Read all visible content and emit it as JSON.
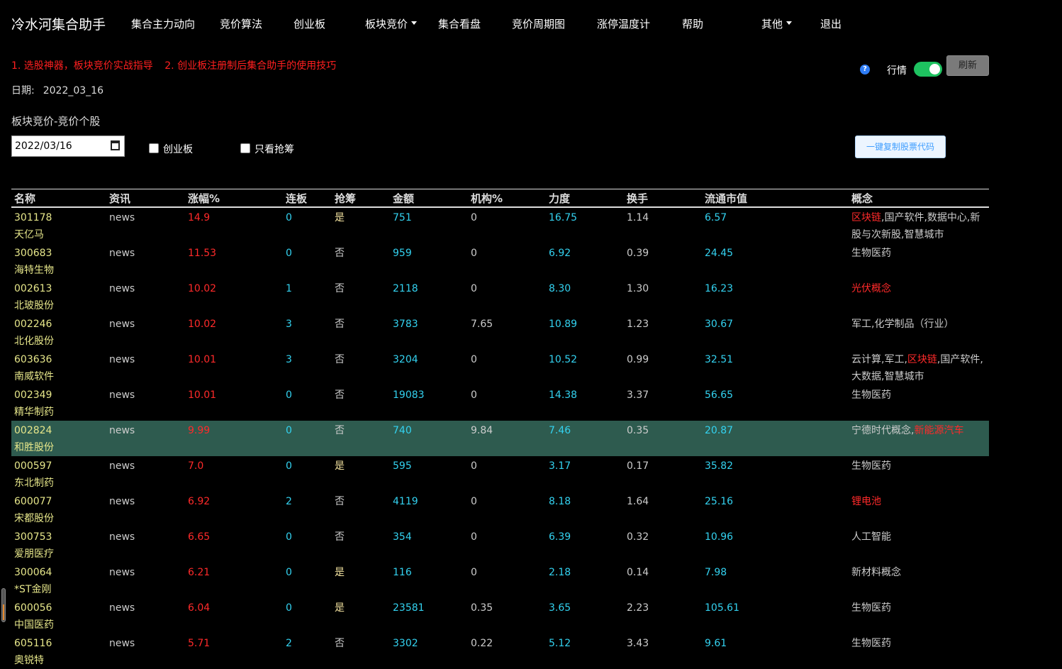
{
  "nav": {
    "brand": "冷水河集合助手",
    "items": [
      {
        "label": "集合主力动向",
        "name": "nav-main-force",
        "dropdown": false
      },
      {
        "label": "竞价算法",
        "name": "nav-bid-algorithm",
        "dropdown": false
      },
      {
        "label": "创业板",
        "name": "nav-gem",
        "dropdown": false
      },
      {
        "label": "板块竞价",
        "name": "nav-sector-bid",
        "dropdown": true
      },
      {
        "label": "集合看盘",
        "name": "nav-watch",
        "dropdown": false
      },
      {
        "label": "竞价周期图",
        "name": "nav-bid-cycle",
        "dropdown": false
      },
      {
        "label": "涨停温度计",
        "name": "nav-limit-up-thermometer",
        "dropdown": false
      },
      {
        "label": "帮助",
        "name": "nav-help",
        "dropdown": false
      },
      {
        "label": "其他",
        "name": "nav-other",
        "dropdown": true
      },
      {
        "label": "退出",
        "name": "nav-logout",
        "dropdown": false
      }
    ]
  },
  "links": {
    "link1": "1. 选股神器，板块竞价实战指导",
    "link2": "2. 创业板注册制后集合助手的使用技巧"
  },
  "date": {
    "label": "日期:",
    "value": "2022_03_16"
  },
  "section_title": "板块竞价-竞价个股",
  "controls": {
    "help_icon": "question-icon",
    "quote_label": "行情",
    "quote_toggle_on": true,
    "refresh_label": "刷新",
    "date_input_value": "2022/03/16",
    "checkbox_gem_label": "创业板",
    "checkbox_gem_checked": false,
    "checkbox_grab_label": "只看抢筹",
    "checkbox_grab_checked": false,
    "copy_button_label": "一键复制股票代码"
  },
  "colors": {
    "background": "#000000",
    "name_color": "#e6e68a",
    "rise_color": "#ff2a2a",
    "cyan_color": "#33d2f0",
    "highlight_row": "#2e5b4f",
    "toggle_on": "#1ec260"
  },
  "table": {
    "headers": [
      "名称",
      "资讯",
      "涨幅%",
      "连板",
      "抢筹",
      "金额",
      "机构%",
      "力度",
      "换手",
      "流通市值",
      "概念"
    ],
    "rows": [
      {
        "code": "301178",
        "name": "天亿马",
        "news": "news",
        "rise": "14.9",
        "boards": "0",
        "grab": "是",
        "amount": "751",
        "inst": "0",
        "force": "16.75",
        "turnover": "1.14",
        "cap": "6.57",
        "highlight": false,
        "concepts": [
          {
            "t": "区块链",
            "hot": true
          },
          {
            "t": ",国产软件,数据中心,新股与次新股,智慧城市",
            "hot": false
          }
        ]
      },
      {
        "code": "300683",
        "name": "海特生物",
        "news": "news",
        "rise": "11.53",
        "boards": "0",
        "grab": "否",
        "amount": "959",
        "inst": "0",
        "force": "6.92",
        "turnover": "0.39",
        "cap": "24.45",
        "highlight": false,
        "concepts": [
          {
            "t": "生物医药",
            "hot": false
          }
        ]
      },
      {
        "code": "002613",
        "name": "北玻股份",
        "news": "news",
        "rise": "10.02",
        "boards": "1",
        "grab": "否",
        "amount": "2118",
        "inst": "0",
        "force": "8.30",
        "turnover": "1.30",
        "cap": "16.23",
        "highlight": false,
        "concepts": [
          {
            "t": "光伏概念",
            "hot": true
          }
        ]
      },
      {
        "code": "002246",
        "name": "北化股份",
        "news": "news",
        "rise": "10.02",
        "boards": "3",
        "grab": "否",
        "amount": "3783",
        "inst": "7.65",
        "force": "10.89",
        "turnover": "1.23",
        "cap": "30.67",
        "highlight": false,
        "concepts": [
          {
            "t": "军工,化学制品（行业）",
            "hot": false
          }
        ]
      },
      {
        "code": "603636",
        "name": "南威软件",
        "news": "news",
        "rise": "10.01",
        "boards": "3",
        "grab": "否",
        "amount": "3204",
        "inst": "0",
        "force": "10.52",
        "turnover": "0.99",
        "cap": "32.51",
        "highlight": false,
        "concepts": [
          {
            "t": "云计算,军工,",
            "hot": false
          },
          {
            "t": "区块链",
            "hot": true
          },
          {
            "t": ",国产软件,大数据,智慧城市",
            "hot": false
          }
        ]
      },
      {
        "code": "002349",
        "name": "精华制药",
        "news": "news",
        "rise": "10.01",
        "boards": "0",
        "grab": "否",
        "amount": "19083",
        "inst": "0",
        "force": "14.38",
        "turnover": "3.37",
        "cap": "56.65",
        "highlight": false,
        "concepts": [
          {
            "t": "生物医药",
            "hot": false
          }
        ]
      },
      {
        "code": "002824",
        "name": "和胜股份",
        "news": "news",
        "rise": "9.99",
        "boards": "0",
        "grab": "否",
        "amount": "740",
        "inst": "9.84",
        "force": "7.46",
        "turnover": "0.35",
        "cap": "20.87",
        "highlight": true,
        "concepts": [
          {
            "t": "宁德时代概念,",
            "hot": false
          },
          {
            "t": "新能源汽车",
            "hot": true
          }
        ]
      },
      {
        "code": "000597",
        "name": "东北制药",
        "news": "news",
        "rise": "7.0",
        "boards": "0",
        "grab": "是",
        "amount": "595",
        "inst": "0",
        "force": "3.17",
        "turnover": "0.17",
        "cap": "35.82",
        "highlight": false,
        "concepts": [
          {
            "t": "生物医药",
            "hot": false
          }
        ]
      },
      {
        "code": "600077",
        "name": "宋都股份",
        "news": "news",
        "rise": "6.92",
        "boards": "2",
        "grab": "否",
        "amount": "4119",
        "inst": "0",
        "force": "8.18",
        "turnover": "1.64",
        "cap": "25.16",
        "highlight": false,
        "concepts": [
          {
            "t": "锂电池",
            "hot": true
          }
        ]
      },
      {
        "code": "300753",
        "name": "爱朋医疗",
        "news": "news",
        "rise": "6.65",
        "boards": "0",
        "grab": "否",
        "amount": "354",
        "inst": "0",
        "force": "6.39",
        "turnover": "0.32",
        "cap": "10.96",
        "highlight": false,
        "concepts": [
          {
            "t": "人工智能",
            "hot": false
          }
        ]
      },
      {
        "code": "300064",
        "name": "*ST金刚",
        "news": "news",
        "rise": "6.21",
        "boards": "0",
        "grab": "是",
        "amount": "116",
        "inst": "0",
        "force": "2.18",
        "turnover": "0.14",
        "cap": "7.98",
        "highlight": false,
        "concepts": [
          {
            "t": "新材料概念",
            "hot": false
          }
        ]
      },
      {
        "code": "600056",
        "name": "中国医药",
        "news": "news",
        "rise": "6.04",
        "boards": "0",
        "grab": "是",
        "amount": "23581",
        "inst": "0.35",
        "force": "3.65",
        "turnover": "2.23",
        "cap": "105.61",
        "highlight": false,
        "concepts": [
          {
            "t": "生物医药",
            "hot": false
          }
        ]
      },
      {
        "code": "605116",
        "name": "奥锐特",
        "news": "news",
        "rise": "5.71",
        "boards": "2",
        "grab": "否",
        "amount": "3302",
        "inst": "0.22",
        "force": "5.12",
        "turnover": "3.43",
        "cap": "9.61",
        "highlight": false,
        "concepts": [
          {
            "t": "生物医药",
            "hot": false
          }
        ]
      }
    ]
  }
}
